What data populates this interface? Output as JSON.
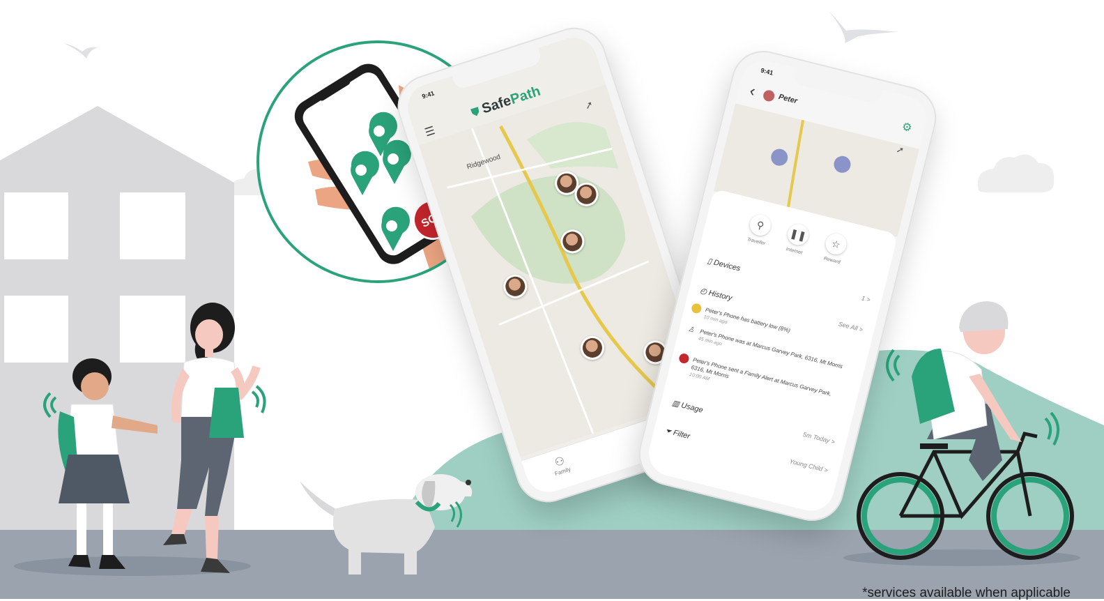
{
  "colors": {
    "accent": "#2aa27a",
    "sos": "#c6262c",
    "road": "#9aa3ae",
    "hill": "#9fcfc3",
    "building": "#d9d9db"
  },
  "badge": {
    "sos_label": "SOS"
  },
  "map_phone": {
    "status_time": "9:41",
    "brand_prefix": "Safe",
    "brand_suffix": "Path",
    "place_label": "Ridgewood",
    "bottom_tab_label": "Family",
    "fab_label": "+",
    "icons": [
      "menu-icon",
      "shield-logo-icon",
      "location-arrow-icon",
      "family-icon"
    ]
  },
  "detail_phone": {
    "status_time": "9:41",
    "back_glyph": "‹",
    "person_name": "Peter",
    "actions": [
      {
        "label": "Traveller",
        "icon": "pin-icon"
      },
      {
        "label": "Internet",
        "icon": "pause-icon"
      },
      {
        "label": "Reward",
        "icon": "star-icon"
      }
    ],
    "devices": {
      "label": "Devices",
      "value": "1 >"
    },
    "history": {
      "label": "History",
      "see_all": "See All >",
      "items": [
        {
          "text": "Peter's Phone has battery low (8%)",
          "time": "10 min ago"
        },
        {
          "text": "Peter's Phone was at Marcus Garvey Park, 6316, Mt Morris",
          "time": "45 min ago"
        },
        {
          "text": "Peter's Phone sent a Family Alert at Marcus Garvey Park, 6316, Mt Morris",
          "time": "10:00 AM"
        }
      ]
    },
    "usage": {
      "label": "Usage",
      "value": "5m Today >"
    },
    "filter": {
      "label": "Filter",
      "value": "Young Child >"
    }
  },
  "footnote": "*services available when applicable"
}
